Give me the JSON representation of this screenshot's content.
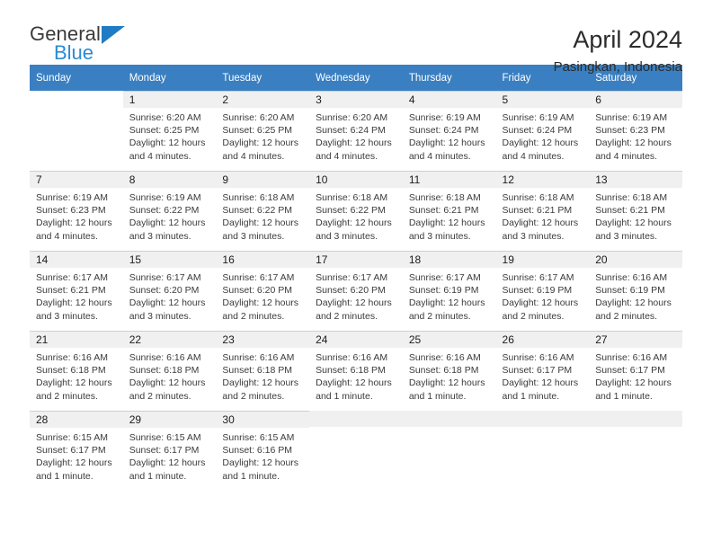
{
  "brand": {
    "name_top": "General",
    "name_bottom": "Blue",
    "triangle_color": "#1f7cc4",
    "blue_color": "#2b8bd4"
  },
  "header": {
    "title": "April 2024",
    "subtitle": "Pasingkan, Indonesia"
  },
  "theme": {
    "header_row_bg": "#3a7fc1",
    "daynum_bg": "#f0f0f0",
    "grid_line": "#cfcfcf"
  },
  "weekday_headers": [
    "Sunday",
    "Monday",
    "Tuesday",
    "Wednesday",
    "Thursday",
    "Friday",
    "Saturday"
  ],
  "weeks": [
    [
      {
        "day": "",
        "sunrise": "",
        "sunset": "",
        "daylight_1": "",
        "daylight_2": "",
        "state": "blank"
      },
      {
        "day": "1",
        "sunrise": "Sunrise: 6:20 AM",
        "sunset": "Sunset: 6:25 PM",
        "daylight_1": "Daylight: 12 hours",
        "daylight_2": "and 4 minutes.",
        "state": "filled"
      },
      {
        "day": "2",
        "sunrise": "Sunrise: 6:20 AM",
        "sunset": "Sunset: 6:25 PM",
        "daylight_1": "Daylight: 12 hours",
        "daylight_2": "and 4 minutes.",
        "state": "filled"
      },
      {
        "day": "3",
        "sunrise": "Sunrise: 6:20 AM",
        "sunset": "Sunset: 6:24 PM",
        "daylight_1": "Daylight: 12 hours",
        "daylight_2": "and 4 minutes.",
        "state": "filled"
      },
      {
        "day": "4",
        "sunrise": "Sunrise: 6:19 AM",
        "sunset": "Sunset: 6:24 PM",
        "daylight_1": "Daylight: 12 hours",
        "daylight_2": "and 4 minutes.",
        "state": "filled"
      },
      {
        "day": "5",
        "sunrise": "Sunrise: 6:19 AM",
        "sunset": "Sunset: 6:24 PM",
        "daylight_1": "Daylight: 12 hours",
        "daylight_2": "and 4 minutes.",
        "state": "filled"
      },
      {
        "day": "6",
        "sunrise": "Sunrise: 6:19 AM",
        "sunset": "Sunset: 6:23 PM",
        "daylight_1": "Daylight: 12 hours",
        "daylight_2": "and 4 minutes.",
        "state": "filled"
      }
    ],
    [
      {
        "day": "7",
        "sunrise": "Sunrise: 6:19 AM",
        "sunset": "Sunset: 6:23 PM",
        "daylight_1": "Daylight: 12 hours",
        "daylight_2": "and 4 minutes.",
        "state": "filled"
      },
      {
        "day": "8",
        "sunrise": "Sunrise: 6:19 AM",
        "sunset": "Sunset: 6:22 PM",
        "daylight_1": "Daylight: 12 hours",
        "daylight_2": "and 3 minutes.",
        "state": "filled"
      },
      {
        "day": "9",
        "sunrise": "Sunrise: 6:18 AM",
        "sunset": "Sunset: 6:22 PM",
        "daylight_1": "Daylight: 12 hours",
        "daylight_2": "and 3 minutes.",
        "state": "filled"
      },
      {
        "day": "10",
        "sunrise": "Sunrise: 6:18 AM",
        "sunset": "Sunset: 6:22 PM",
        "daylight_1": "Daylight: 12 hours",
        "daylight_2": "and 3 minutes.",
        "state": "filled"
      },
      {
        "day": "11",
        "sunrise": "Sunrise: 6:18 AM",
        "sunset": "Sunset: 6:21 PM",
        "daylight_1": "Daylight: 12 hours",
        "daylight_2": "and 3 minutes.",
        "state": "filled"
      },
      {
        "day": "12",
        "sunrise": "Sunrise: 6:18 AM",
        "sunset": "Sunset: 6:21 PM",
        "daylight_1": "Daylight: 12 hours",
        "daylight_2": "and 3 minutes.",
        "state": "filled"
      },
      {
        "day": "13",
        "sunrise": "Sunrise: 6:18 AM",
        "sunset": "Sunset: 6:21 PM",
        "daylight_1": "Daylight: 12 hours",
        "daylight_2": "and 3 minutes.",
        "state": "filled"
      }
    ],
    [
      {
        "day": "14",
        "sunrise": "Sunrise: 6:17 AM",
        "sunset": "Sunset: 6:21 PM",
        "daylight_1": "Daylight: 12 hours",
        "daylight_2": "and 3 minutes.",
        "state": "filled"
      },
      {
        "day": "15",
        "sunrise": "Sunrise: 6:17 AM",
        "sunset": "Sunset: 6:20 PM",
        "daylight_1": "Daylight: 12 hours",
        "daylight_2": "and 3 minutes.",
        "state": "filled"
      },
      {
        "day": "16",
        "sunrise": "Sunrise: 6:17 AM",
        "sunset": "Sunset: 6:20 PM",
        "daylight_1": "Daylight: 12 hours",
        "daylight_2": "and 2 minutes.",
        "state": "filled"
      },
      {
        "day": "17",
        "sunrise": "Sunrise: 6:17 AM",
        "sunset": "Sunset: 6:20 PM",
        "daylight_1": "Daylight: 12 hours",
        "daylight_2": "and 2 minutes.",
        "state": "filled"
      },
      {
        "day": "18",
        "sunrise": "Sunrise: 6:17 AM",
        "sunset": "Sunset: 6:19 PM",
        "daylight_1": "Daylight: 12 hours",
        "daylight_2": "and 2 minutes.",
        "state": "filled"
      },
      {
        "day": "19",
        "sunrise": "Sunrise: 6:17 AM",
        "sunset": "Sunset: 6:19 PM",
        "daylight_1": "Daylight: 12 hours",
        "daylight_2": "and 2 minutes.",
        "state": "filled"
      },
      {
        "day": "20",
        "sunrise": "Sunrise: 6:16 AM",
        "sunset": "Sunset: 6:19 PM",
        "daylight_1": "Daylight: 12 hours",
        "daylight_2": "and 2 minutes.",
        "state": "filled"
      }
    ],
    [
      {
        "day": "21",
        "sunrise": "Sunrise: 6:16 AM",
        "sunset": "Sunset: 6:18 PM",
        "daylight_1": "Daylight: 12 hours",
        "daylight_2": "and 2 minutes.",
        "state": "filled"
      },
      {
        "day": "22",
        "sunrise": "Sunrise: 6:16 AM",
        "sunset": "Sunset: 6:18 PM",
        "daylight_1": "Daylight: 12 hours",
        "daylight_2": "and 2 minutes.",
        "state": "filled"
      },
      {
        "day": "23",
        "sunrise": "Sunrise: 6:16 AM",
        "sunset": "Sunset: 6:18 PM",
        "daylight_1": "Daylight: 12 hours",
        "daylight_2": "and 2 minutes.",
        "state": "filled"
      },
      {
        "day": "24",
        "sunrise": "Sunrise: 6:16 AM",
        "sunset": "Sunset: 6:18 PM",
        "daylight_1": "Daylight: 12 hours",
        "daylight_2": "and 1 minute.",
        "state": "filled"
      },
      {
        "day": "25",
        "sunrise": "Sunrise: 6:16 AM",
        "sunset": "Sunset: 6:18 PM",
        "daylight_1": "Daylight: 12 hours",
        "daylight_2": "and 1 minute.",
        "state": "filled"
      },
      {
        "day": "26",
        "sunrise": "Sunrise: 6:16 AM",
        "sunset": "Sunset: 6:17 PM",
        "daylight_1": "Daylight: 12 hours",
        "daylight_2": "and 1 minute.",
        "state": "filled"
      },
      {
        "day": "27",
        "sunrise": "Sunrise: 6:16 AM",
        "sunset": "Sunset: 6:17 PM",
        "daylight_1": "Daylight: 12 hours",
        "daylight_2": "and 1 minute.",
        "state": "filled"
      }
    ],
    [
      {
        "day": "28",
        "sunrise": "Sunrise: 6:15 AM",
        "sunset": "Sunset: 6:17 PM",
        "daylight_1": "Daylight: 12 hours",
        "daylight_2": "and 1 minute.",
        "state": "filled"
      },
      {
        "day": "29",
        "sunrise": "Sunrise: 6:15 AM",
        "sunset": "Sunset: 6:17 PM",
        "daylight_1": "Daylight: 12 hours",
        "daylight_2": "and 1 minute.",
        "state": "filled"
      },
      {
        "day": "30",
        "sunrise": "Sunrise: 6:15 AM",
        "sunset": "Sunset: 6:16 PM",
        "daylight_1": "Daylight: 12 hours",
        "daylight_2": "and 1 minute.",
        "state": "filled"
      },
      {
        "day": "",
        "sunrise": "",
        "sunset": "",
        "daylight_1": "",
        "daylight_2": "",
        "state": "empty"
      },
      {
        "day": "",
        "sunrise": "",
        "sunset": "",
        "daylight_1": "",
        "daylight_2": "",
        "state": "empty"
      },
      {
        "day": "",
        "sunrise": "",
        "sunset": "",
        "daylight_1": "",
        "daylight_2": "",
        "state": "empty"
      },
      {
        "day": "",
        "sunrise": "",
        "sunset": "",
        "daylight_1": "",
        "daylight_2": "",
        "state": "empty"
      }
    ]
  ]
}
